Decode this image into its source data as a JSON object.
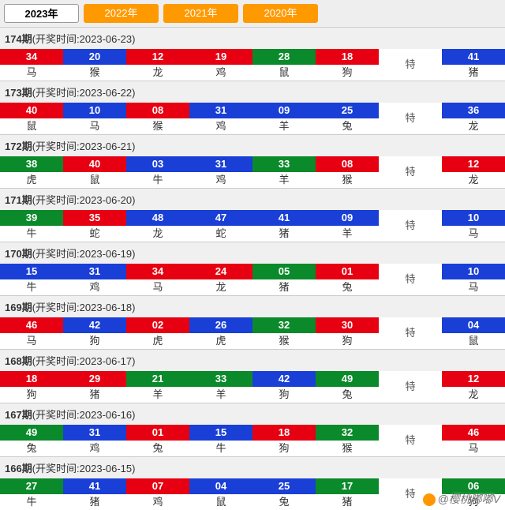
{
  "tabs": [
    {
      "label": "2023年",
      "active": true
    },
    {
      "label": "2022年",
      "active": false
    },
    {
      "label": "2021年",
      "active": false
    },
    {
      "label": "2020年",
      "active": false
    }
  ],
  "special_label": "特",
  "draws": [
    {
      "issue": "174",
      "date": "2023-06-23",
      "balls": [
        {
          "n": "34",
          "c": "red",
          "z": "马"
        },
        {
          "n": "20",
          "c": "blue",
          "z": "猴"
        },
        {
          "n": "12",
          "c": "red",
          "z": "龙"
        },
        {
          "n": "19",
          "c": "red",
          "z": "鸡"
        },
        {
          "n": "28",
          "c": "green",
          "z": "鼠"
        },
        {
          "n": "18",
          "c": "red",
          "z": "狗"
        }
      ],
      "special": {
        "n": "41",
        "c": "blue",
        "z": "猪"
      }
    },
    {
      "issue": "173",
      "date": "2023-06-22",
      "balls": [
        {
          "n": "40",
          "c": "red",
          "z": "鼠"
        },
        {
          "n": "10",
          "c": "blue",
          "z": "马"
        },
        {
          "n": "08",
          "c": "red",
          "z": "猴"
        },
        {
          "n": "31",
          "c": "blue",
          "z": "鸡"
        },
        {
          "n": "09",
          "c": "blue",
          "z": "羊"
        },
        {
          "n": "25",
          "c": "blue",
          "z": "兔"
        }
      ],
      "special": {
        "n": "36",
        "c": "blue",
        "z": "龙"
      }
    },
    {
      "issue": "172",
      "date": "2023-06-21",
      "balls": [
        {
          "n": "38",
          "c": "green",
          "z": "虎"
        },
        {
          "n": "40",
          "c": "red",
          "z": "鼠"
        },
        {
          "n": "03",
          "c": "blue",
          "z": "牛"
        },
        {
          "n": "31",
          "c": "blue",
          "z": "鸡"
        },
        {
          "n": "33",
          "c": "green",
          "z": "羊"
        },
        {
          "n": "08",
          "c": "red",
          "z": "猴"
        }
      ],
      "special": {
        "n": "12",
        "c": "red",
        "z": "龙"
      }
    },
    {
      "issue": "171",
      "date": "2023-06-20",
      "balls": [
        {
          "n": "39",
          "c": "green",
          "z": "牛"
        },
        {
          "n": "35",
          "c": "red",
          "z": "蛇"
        },
        {
          "n": "48",
          "c": "blue",
          "z": "龙"
        },
        {
          "n": "47",
          "c": "blue",
          "z": "蛇"
        },
        {
          "n": "41",
          "c": "blue",
          "z": "猪"
        },
        {
          "n": "09",
          "c": "blue",
          "z": "羊"
        }
      ],
      "special": {
        "n": "10",
        "c": "blue",
        "z": "马"
      }
    },
    {
      "issue": "170",
      "date": "2023-06-19",
      "balls": [
        {
          "n": "15",
          "c": "blue",
          "z": "牛"
        },
        {
          "n": "31",
          "c": "blue",
          "z": "鸡"
        },
        {
          "n": "34",
          "c": "red",
          "z": "马"
        },
        {
          "n": "24",
          "c": "red",
          "z": "龙"
        },
        {
          "n": "05",
          "c": "green",
          "z": "猪"
        },
        {
          "n": "01",
          "c": "red",
          "z": "兔"
        }
      ],
      "special": {
        "n": "10",
        "c": "blue",
        "z": "马"
      }
    },
    {
      "issue": "169",
      "date": "2023-06-18",
      "balls": [
        {
          "n": "46",
          "c": "red",
          "z": "马"
        },
        {
          "n": "42",
          "c": "blue",
          "z": "狗"
        },
        {
          "n": "02",
          "c": "red",
          "z": "虎"
        },
        {
          "n": "26",
          "c": "blue",
          "z": "虎"
        },
        {
          "n": "32",
          "c": "green",
          "z": "猴"
        },
        {
          "n": "30",
          "c": "red",
          "z": "狗"
        }
      ],
      "special": {
        "n": "04",
        "c": "blue",
        "z": "鼠"
      }
    },
    {
      "issue": "168",
      "date": "2023-06-17",
      "balls": [
        {
          "n": "18",
          "c": "red",
          "z": "狗"
        },
        {
          "n": "29",
          "c": "red",
          "z": "猪"
        },
        {
          "n": "21",
          "c": "green",
          "z": "羊"
        },
        {
          "n": "33",
          "c": "green",
          "z": "羊"
        },
        {
          "n": "42",
          "c": "blue",
          "z": "狗"
        },
        {
          "n": "49",
          "c": "green",
          "z": "兔"
        }
      ],
      "special": {
        "n": "12",
        "c": "red",
        "z": "龙"
      }
    },
    {
      "issue": "167",
      "date": "2023-06-16",
      "balls": [
        {
          "n": "49",
          "c": "green",
          "z": "兔"
        },
        {
          "n": "31",
          "c": "blue",
          "z": "鸡"
        },
        {
          "n": "01",
          "c": "red",
          "z": "兔"
        },
        {
          "n": "15",
          "c": "blue",
          "z": "牛"
        },
        {
          "n": "18",
          "c": "red",
          "z": "狗"
        },
        {
          "n": "32",
          "c": "green",
          "z": "猴"
        }
      ],
      "special": {
        "n": "46",
        "c": "red",
        "z": "马"
      }
    },
    {
      "issue": "166",
      "date": "2023-06-15",
      "balls": [
        {
          "n": "27",
          "c": "green",
          "z": "牛"
        },
        {
          "n": "41",
          "c": "blue",
          "z": "猪"
        },
        {
          "n": "07",
          "c": "red",
          "z": "鸡"
        },
        {
          "n": "04",
          "c": "blue",
          "z": "鼠"
        },
        {
          "n": "25",
          "c": "blue",
          "z": "兔"
        },
        {
          "n": "17",
          "c": "green",
          "z": "猪"
        }
      ],
      "special": {
        "n": "06",
        "c": "green",
        "z": "狗"
      }
    }
  ],
  "watermark": "@樱桃嘟嘟V"
}
